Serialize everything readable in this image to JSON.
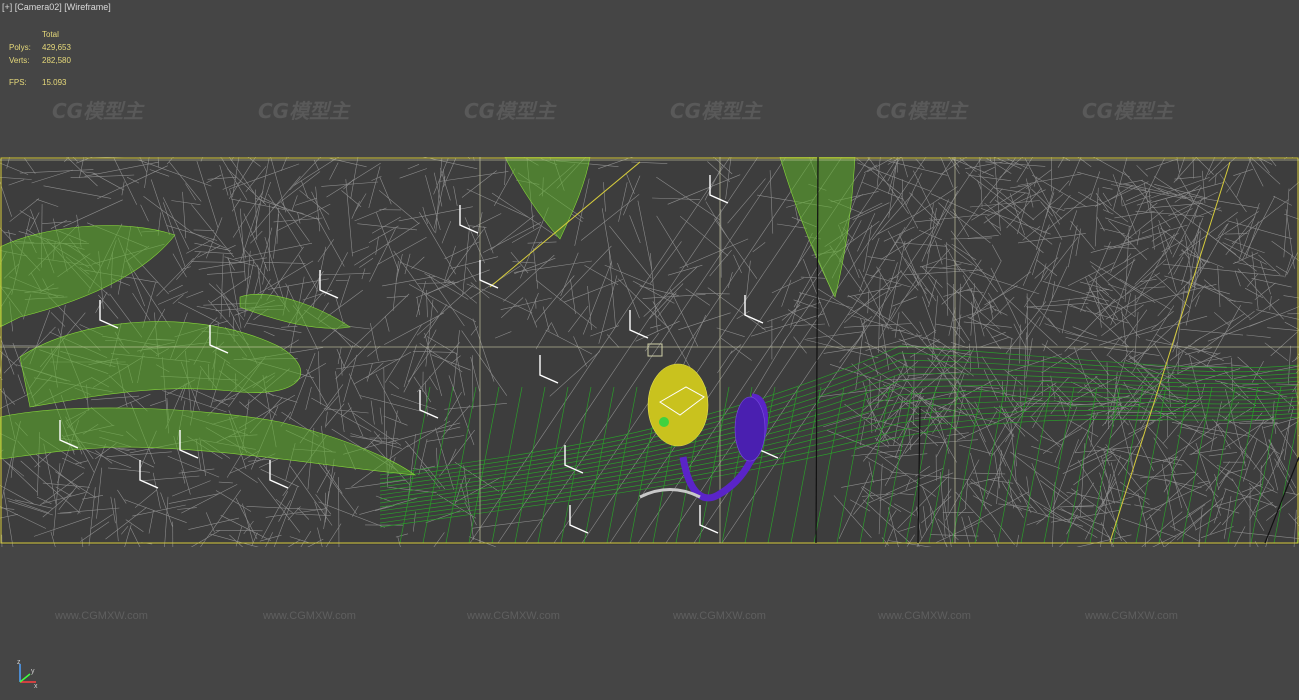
{
  "viewport": {
    "label": "[+] [Camera02] [Wireframe]"
  },
  "stats": {
    "header": "Total",
    "polys_label": "Polys:",
    "polys_value": "429,653",
    "verts_label": "Verts:",
    "verts_value": "282,580",
    "fps_label": "FPS:",
    "fps_value": "15.093"
  },
  "watermarks": {
    "logo_text": "CG模型主",
    "url_text": "www.CGMXW.com"
  },
  "axis": {
    "x": "x",
    "y": "y",
    "z": "z"
  },
  "colors": {
    "background": "#454545",
    "scene_bg": "#3c3c3c",
    "wire_gray": "#a8a8a8",
    "wire_green": "#7fd43a",
    "wire_dark_green": "#2a9a2a",
    "wire_yellow": "#d9cf3a",
    "fruit": "#c8c020",
    "purple": "#5a24c8"
  }
}
